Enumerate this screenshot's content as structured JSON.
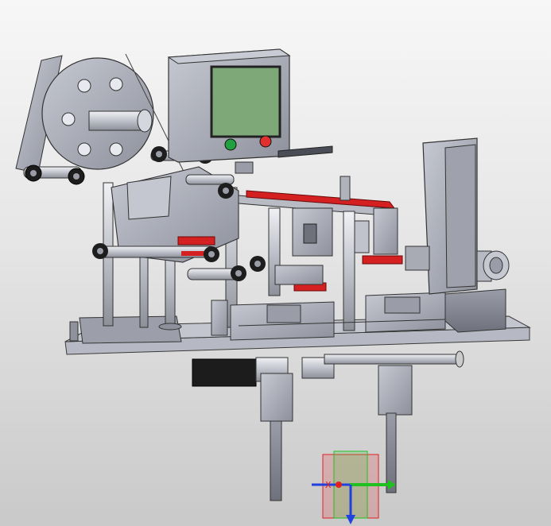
{
  "viewport": {
    "background_top": "#f7f7f7",
    "background_bottom": "#c9c9c9",
    "model_color": "#a9acb6",
    "accent_red": "#d42020",
    "screen_color": "#7ea878"
  },
  "triad": {
    "x_label": "X",
    "x_axis_color": "#e02020",
    "y_axis_color": "#20c020",
    "z_axis_color": "#2040e0"
  },
  "hmi": {
    "screen_color": "#7ea878",
    "start_button_color": "#20a040",
    "stop_button_color": "#e03030"
  }
}
